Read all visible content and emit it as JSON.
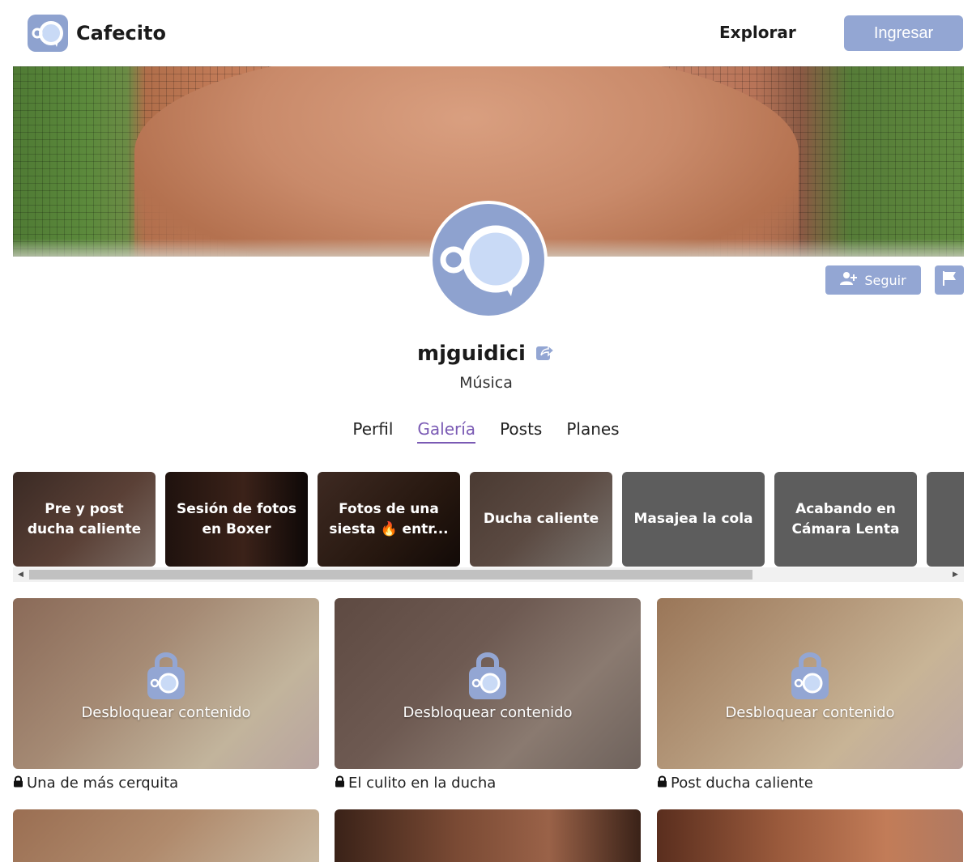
{
  "header": {
    "brand": "Cafecito",
    "explore": "Explorar",
    "login": "Ingresar"
  },
  "profile": {
    "username": "mjguidici",
    "category": "Música",
    "follow": "Seguir"
  },
  "tabs": [
    {
      "label": "Perfil",
      "active": false
    },
    {
      "label": "Galería",
      "active": true
    },
    {
      "label": "Posts",
      "active": false
    },
    {
      "label": "Planes",
      "active": false
    }
  ],
  "albums": [
    {
      "title": "Pre y post ducha caliente"
    },
    {
      "title": "Sesión de fotos en Boxer"
    },
    {
      "title": "Fotos de una siesta 🔥 entr..."
    },
    {
      "title": "Ducha caliente"
    },
    {
      "title": "Masajea la cola"
    },
    {
      "title": "Acabando en Cámara Lenta"
    }
  ],
  "gallery": {
    "unlock_label": "Desbloquear contenido",
    "items": [
      {
        "caption": "Una de más cerquita"
      },
      {
        "caption": "El culito en la ducha"
      },
      {
        "caption": "Post ducha caliente"
      }
    ]
  },
  "colors": {
    "accent": "#93a6d3",
    "active_tab": "#7a5ab4"
  }
}
